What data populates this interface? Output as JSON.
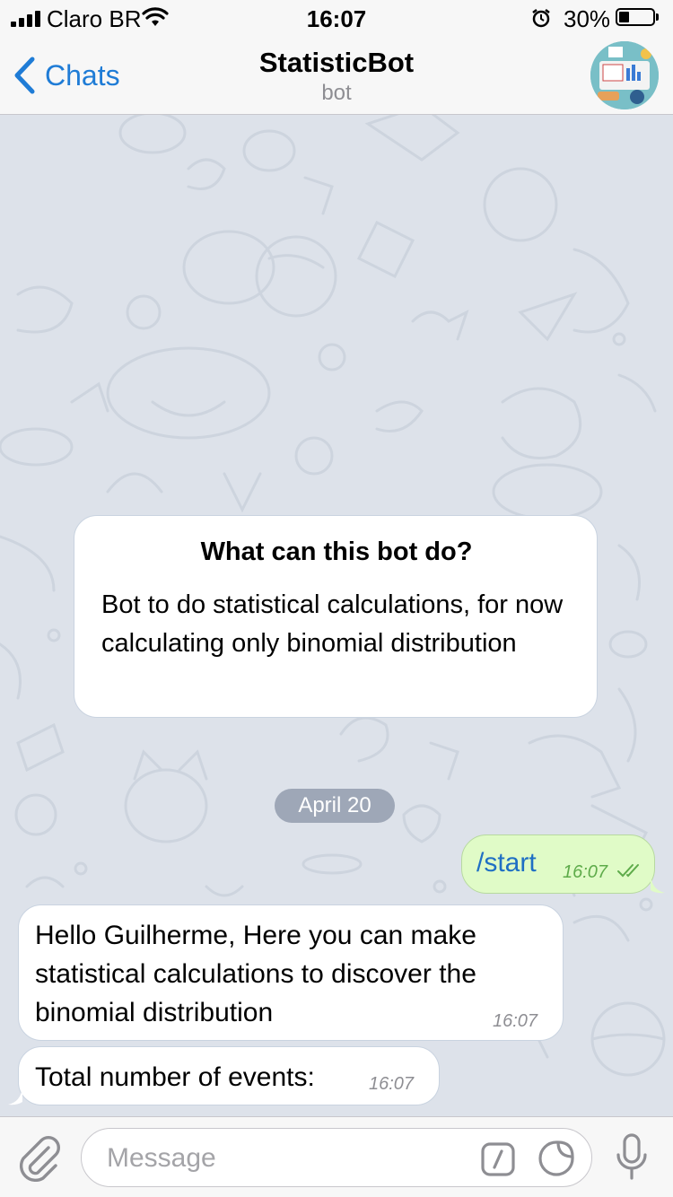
{
  "status_bar": {
    "carrier": "Claro BR",
    "time": "16:07",
    "battery_percent": "30%",
    "battery_level": 0.3
  },
  "nav": {
    "back_label": "Chats",
    "title": "StatisticBot",
    "subtitle": "bot"
  },
  "info_card": {
    "title": "What can this bot do?",
    "text": "Bot to do statistical calculations, for now calculating only binomial distribution"
  },
  "date_separator": "April 20",
  "messages": [
    {
      "direction": "outgoing",
      "text": "/start",
      "time": "16:07",
      "status": "read"
    },
    {
      "direction": "incoming",
      "text": "Hello Guilherme, Here you can make statistical calculations to discover the binomial distribution",
      "time": "16:07"
    },
    {
      "direction": "incoming",
      "text": "Total number of events:",
      "time": "16:07"
    }
  ],
  "input": {
    "placeholder": "Message",
    "value": ""
  },
  "icons": {
    "back": "chevron-left-icon",
    "attach": "paperclip-icon",
    "commands": "slash-command-icon",
    "sticker": "sticker-icon",
    "mic": "microphone-icon"
  },
  "colors": {
    "accent": "#1f7cd6",
    "outgoing_bubble": "#e0fbc7",
    "chat_background": "#dde2ea"
  }
}
